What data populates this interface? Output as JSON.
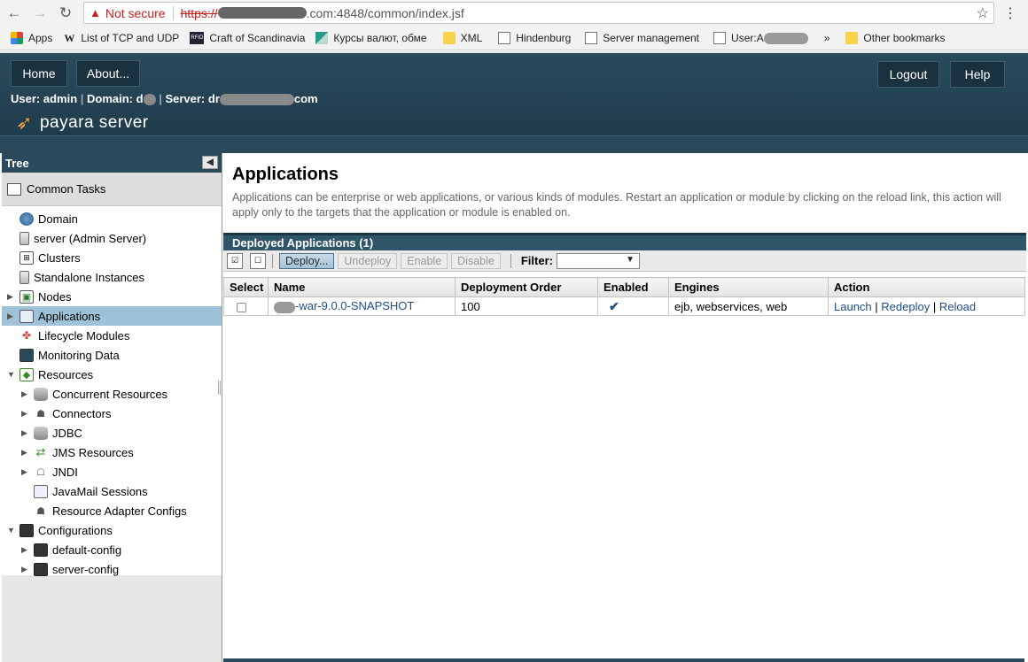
{
  "browser": {
    "not_secure": "Not secure",
    "url_scheme": "https://",
    "url_rest": ".com:4848/common/index.jsf",
    "bookmarks": [
      {
        "label": "Apps",
        "icon": "apps-grid-icon"
      },
      {
        "label": "List of TCP and UDP",
        "icon": "wikipedia-icon"
      },
      {
        "label": "Craft of Scandinavia",
        "icon": "rfid-icon"
      },
      {
        "label": "Курсы валют, обме",
        "icon": "green-triangle-icon"
      },
      {
        "label": "XML",
        "icon": "folder-icon"
      },
      {
        "label": "Hindenburg",
        "icon": "page-icon"
      },
      {
        "label": "Server management",
        "icon": "page-icon"
      },
      {
        "label": "User:A",
        "icon": "page-icon"
      }
    ],
    "overflow": "»",
    "other_bookmarks": "Other bookmarks"
  },
  "header": {
    "home": "Home",
    "about": "About...",
    "logout": "Logout",
    "help": "Help",
    "user_label": "User: admin",
    "domain_label": "Domain: d",
    "server_label": "Server: dr",
    "server_suffix": "com",
    "logo_text": "payara server"
  },
  "tree": {
    "title": "Tree",
    "common_tasks": "Common Tasks",
    "nodes": [
      {
        "label": "Domain"
      },
      {
        "label": "server (Admin Server)"
      },
      {
        "label": "Clusters"
      },
      {
        "label": "Standalone Instances"
      },
      {
        "label": "Nodes"
      },
      {
        "label": "Applications"
      },
      {
        "label": "Lifecycle Modules"
      },
      {
        "label": "Monitoring Data"
      },
      {
        "label": "Resources"
      },
      {
        "label": "Concurrent Resources"
      },
      {
        "label": "Connectors"
      },
      {
        "label": "JDBC"
      },
      {
        "label": "JMS Resources"
      },
      {
        "label": "JNDI"
      },
      {
        "label": "JavaMail Sessions"
      },
      {
        "label": "Resource Adapter Configs"
      },
      {
        "label": "Configurations"
      },
      {
        "label": "default-config"
      },
      {
        "label": "server-config"
      }
    ]
  },
  "main": {
    "title": "Applications",
    "description": "Applications can be enterprise or web applications, or various kinds of modules. Restart an application or module by clicking on the reload link, this action will apply only to the targets that the application or module is enabled on.",
    "table_title": "Deployed Applications (1)",
    "toolbar": {
      "deploy": "Deploy...",
      "undeploy": "Undeploy",
      "enable": "Enable",
      "disable": "Disable",
      "filter": "Filter:"
    },
    "columns": [
      "Select",
      "Name",
      "Deployment Order",
      "Enabled",
      "Engines",
      "Action"
    ],
    "row": {
      "name": "-war-9.0.0-SNAPSHOT",
      "order": "100",
      "enabled": "✔",
      "engines": "ejb, webservices, web",
      "launch": "Launch",
      "redeploy": "Redeploy",
      "reload": "Reload",
      "sep": "|"
    }
  }
}
